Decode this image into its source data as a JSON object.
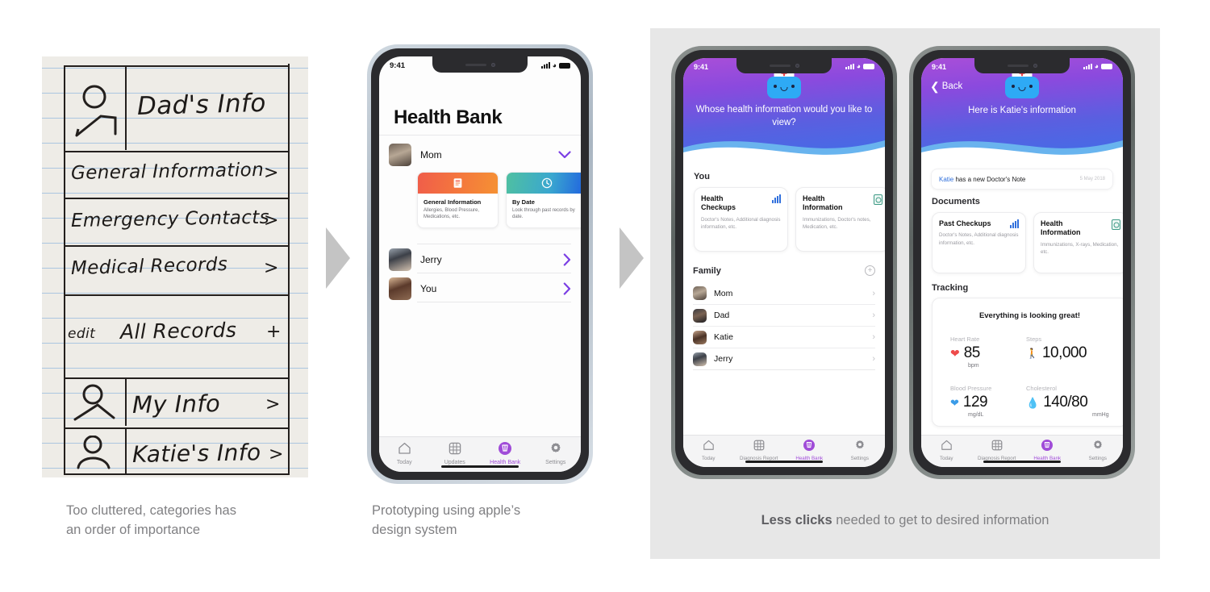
{
  "sketch": {
    "rows": [
      {
        "icon": "person-icon",
        "label": "Dad's Info"
      },
      {
        "label": "General Information",
        "affordance": ">"
      },
      {
        "label": "Emergency Contacts",
        "affordance": ">"
      },
      {
        "label": "Medical Records",
        "affordance": ">"
      },
      {
        "prefix": "edit",
        "label": "All Records",
        "affordance": "+"
      },
      {
        "icon": "person-icon",
        "label": "My Info",
        "affordance": ">"
      },
      {
        "icon": "person-icon",
        "label": "Katie's Info",
        "affordance": ">"
      }
    ]
  },
  "captions": {
    "sketch": "Too cluttered, categories has\nan order of importance",
    "prototype": "Prototyping using apple’s\ndesign system",
    "final_bold": "Less clicks",
    "final_rest": " needed to get to desired information"
  },
  "phone2": {
    "status": {
      "time": "9:41",
      "signal": "signal-icon",
      "wifi": "wifi-icon",
      "battery": "battery-icon"
    },
    "title": "Health Bank",
    "expanded_person": "Mom",
    "cards": [
      {
        "title": "General Information",
        "subtitle": "Allergies, Blood Pressure, Medications, etc.",
        "icon": "book-icon",
        "accent": "#f05d4a"
      },
      {
        "title": "By Date",
        "subtitle": "Look through past records by date.",
        "icon": "clock-icon",
        "accent": "#1f5fe0"
      }
    ],
    "people": [
      {
        "name": "Jerry",
        "chevron": ">"
      },
      {
        "name": "You",
        "chevron": ">"
      }
    ],
    "tabs": [
      {
        "label": "Today",
        "icon": "home-icon",
        "active": false
      },
      {
        "label": "Updates",
        "icon": "grid-icon",
        "active": false
      },
      {
        "label": "Health Bank",
        "icon": "health-bank-icon",
        "active": true
      },
      {
        "label": "Settings",
        "icon": "gear-icon",
        "active": false
      }
    ],
    "accent": "#7b3fe4"
  },
  "phone3": {
    "status": {
      "time": "9:41"
    },
    "mascot": "nurse-robot-icon",
    "hero_question": "Whose health information would you like to view?",
    "section_you": "You",
    "you_cards": [
      {
        "title": "Health Checkups",
        "subtitle": "Doctor's Notes, Additional diagnosis information, etc.",
        "icon": "bar-chart-icon"
      },
      {
        "title": "Health Information",
        "subtitle": "Immunizations, Doctor's notes, Medication, etc.",
        "icon": "document-icon"
      }
    ],
    "section_family": "Family",
    "add_label": "+",
    "family": [
      {
        "name": "Mom",
        "chevron": "›"
      },
      {
        "name": "Dad",
        "chevron": "›"
      },
      {
        "name": "Katie",
        "chevron": "›"
      },
      {
        "name": "Jerry",
        "chevron": "›"
      }
    ],
    "tabs": [
      {
        "label": "Today",
        "icon": "home-icon",
        "active": false
      },
      {
        "label": "Diagnosis Report",
        "icon": "grid-icon",
        "active": false
      },
      {
        "label": "Health Bank",
        "icon": "health-bank-icon",
        "active": true
      },
      {
        "label": "Settings",
        "icon": "gear-icon",
        "active": false
      }
    ]
  },
  "phone4": {
    "status": {
      "time": "9:41"
    },
    "back_label": "Back",
    "mascot": "nurse-robot-icon",
    "hero_title": "Here is Katie's information",
    "notification": {
      "person": "Katie",
      "text": " has a new Doctor's Note",
      "date": "5 May 2018"
    },
    "section_documents": "Documents",
    "doc_cards": [
      {
        "title": "Past Checkups",
        "subtitle": "Doctor's Notes, Additional diagnosis information, etc.",
        "icon": "bar-chart-icon"
      },
      {
        "title": "Health Information",
        "subtitle": "Immunizations, X-rays, Medication, etc.",
        "icon": "document-icon"
      }
    ],
    "section_tracking": "Tracking",
    "tracking_headline": "Everything is looking great!",
    "metrics": [
      {
        "label": "Heart Rate",
        "value": "85",
        "unit": "bpm",
        "icon": "heart-icon",
        "color": "#ee4b4b"
      },
      {
        "label": "Steps",
        "value": "10,000",
        "unit": "",
        "icon": "footsteps-icon",
        "color": "#2e9e84"
      },
      {
        "label": "Blood Pressure",
        "value": "129",
        "unit": "mg/dL",
        "icon": "blood-drop-icon",
        "color": "#3b9ce8"
      },
      {
        "label": "Cholesterol",
        "value": "140/80",
        "unit": "mmHg",
        "icon": "cholesterol-icon",
        "color": "#f2783c"
      }
    ],
    "tabs": [
      {
        "label": "Today",
        "icon": "home-icon",
        "active": false
      },
      {
        "label": "Diagnosis Report",
        "icon": "grid-icon",
        "active": false
      },
      {
        "label": "Health Bank",
        "icon": "health-bank-icon",
        "active": true
      },
      {
        "label": "Settings",
        "icon": "gear-icon",
        "active": false
      }
    ]
  }
}
